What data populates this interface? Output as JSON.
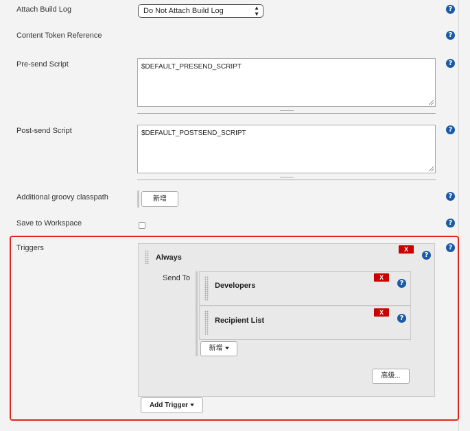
{
  "attach_build_log": {
    "label": "Attach Build Log",
    "value": "Do Not Attach Build Log"
  },
  "content_token_reference": {
    "label": "Content Token Reference"
  },
  "pre_send_script": {
    "label": "Pre-send Script",
    "value": "$DEFAULT_PRESEND_SCRIPT"
  },
  "post_send_script": {
    "label": "Post-send Script",
    "value": "$DEFAULT_POSTSEND_SCRIPT"
  },
  "additional_groovy_classpath": {
    "label": "Additional groovy classpath",
    "add_button": "新增"
  },
  "save_to_workspace": {
    "label": "Save to Workspace",
    "checked": false
  },
  "help_glyph": "?",
  "triggers": {
    "label": "Triggers",
    "items": [
      {
        "name": "Always",
        "delete_label": "X",
        "send_to_label": "Send To",
        "recipients": [
          {
            "name": "Developers",
            "delete_label": "X"
          },
          {
            "name": "Recipient List",
            "delete_label": "X"
          }
        ],
        "add_button": "新增",
        "advanced_button": "高级..."
      }
    ],
    "add_trigger_button": "Add Trigger"
  },
  "colors": {
    "highlight": "#e2231a",
    "help": "#1a5aa8",
    "delete": "#cc0000"
  }
}
